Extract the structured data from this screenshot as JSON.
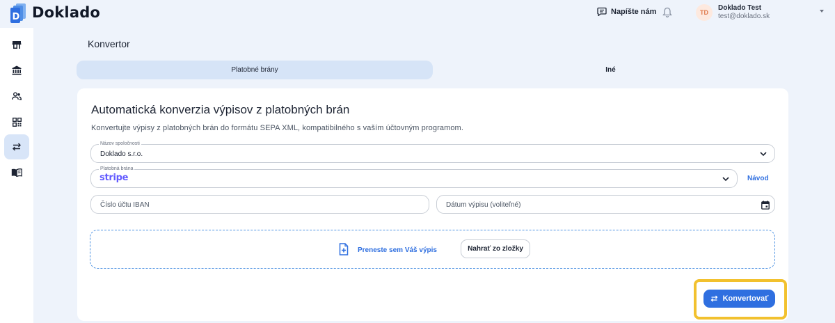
{
  "app": {
    "name": "Doklado"
  },
  "header": {
    "write_us": "Napíšte nám",
    "user": {
      "initials": "TD",
      "name": "Doklado Test",
      "email": "test@doklado.sk"
    }
  },
  "sidebar": {
    "items": [
      {
        "icon": "store-icon",
        "active": false
      },
      {
        "icon": "bank-icon",
        "active": false
      },
      {
        "icon": "people-icon",
        "active": false
      },
      {
        "icon": "qr-code-icon",
        "active": false
      },
      {
        "icon": "swap-icon",
        "active": true
      },
      {
        "icon": "book-icon",
        "active": false
      }
    ]
  },
  "page": {
    "title": "Konvertor",
    "tabs": [
      {
        "label": "Platobné brány",
        "active": true
      },
      {
        "label": "Iné",
        "active": false
      }
    ]
  },
  "card": {
    "title": "Automatická konverzia výpisov z platobných brán",
    "description": "Konvertujte výpisy z platobných brán do formátu SEPA XML, kompatibilného s vaším účtovným programom.",
    "company": {
      "label": "Názov spoločnosti",
      "value": "Doklado s.r.o."
    },
    "gateway": {
      "label": "Platobná brána",
      "value": "stripe"
    },
    "guide_link": "Návod",
    "iban": {
      "placeholder": "Číslo účtu IBAN"
    },
    "statement_date": {
      "placeholder": "Dátum výpisu (voliteľné)"
    },
    "dropzone": {
      "text": "Preneste sem Váš výpis",
      "upload_button": "Nahrať zo zložky"
    },
    "convert_button": "Konvertovať"
  },
  "colors": {
    "accent": "#2f6fe0",
    "highlight": "#f2c12e",
    "stripe": "#635bff",
    "tab_active": "#d6e4f7"
  }
}
